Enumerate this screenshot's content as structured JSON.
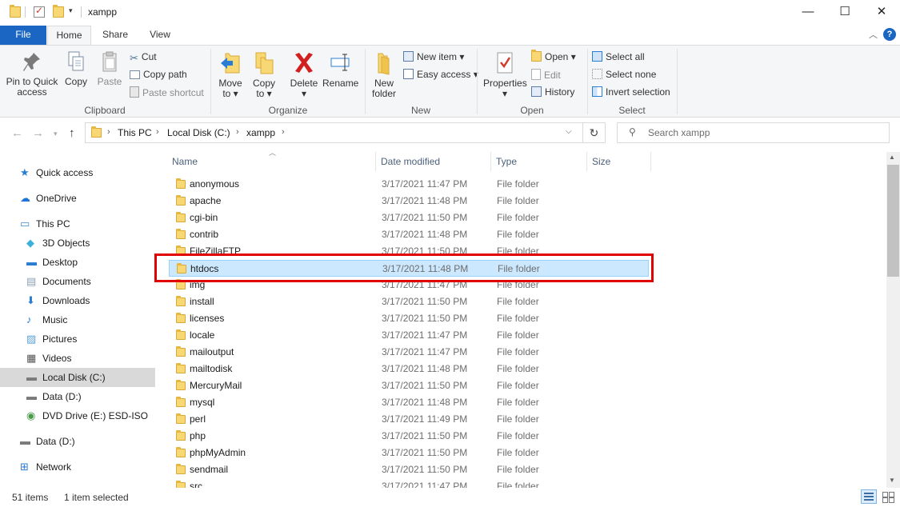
{
  "window": {
    "title": "xampp",
    "minimize": "—",
    "maximize": "☐",
    "close": "✕"
  },
  "tabs": {
    "file": "File",
    "home": "Home",
    "share": "Share",
    "view": "View"
  },
  "ribbon": {
    "clipboard": {
      "label": "Clipboard",
      "pin": "Pin to Quick access",
      "pin_l1": "Pin to Quick",
      "pin_l2": "access",
      "copy": "Copy",
      "paste": "Paste",
      "cut": "Cut",
      "copy_path": "Copy path",
      "paste_shortcut": "Paste shortcut"
    },
    "organize": {
      "label": "Organize",
      "move_to": "Move",
      "move_to2": "to",
      "copy_to": "Copy",
      "copy_to2": "to",
      "delete": "Delete",
      "rename": "Rename"
    },
    "new": {
      "label": "New",
      "new_folder_l1": "New",
      "new_folder_l2": "folder",
      "new_item": "New item",
      "easy_access": "Easy access"
    },
    "open": {
      "label": "Open",
      "properties": "Properties",
      "open": "Open",
      "edit": "Edit",
      "history": "History"
    },
    "select": {
      "label": "Select",
      "select_all": "Select all",
      "select_none": "Select none",
      "invert": "Invert selection"
    }
  },
  "address": {
    "crumbs": [
      "This PC",
      "Local Disk (C:)",
      "xampp"
    ],
    "search_placeholder": "Search xampp"
  },
  "nav": [
    {
      "label": "Quick access",
      "icon": "star-icon",
      "indent": 1
    },
    {
      "label": "OneDrive",
      "icon": "cloud-icon",
      "indent": 1
    },
    {
      "label": "This PC",
      "icon": "computer-icon",
      "indent": 1
    },
    {
      "label": "3D Objects",
      "icon": "cube-icon",
      "indent": 2
    },
    {
      "label": "Desktop",
      "icon": "desktop-icon",
      "indent": 2
    },
    {
      "label": "Documents",
      "icon": "document-icon",
      "indent": 2
    },
    {
      "label": "Downloads",
      "icon": "download-icon",
      "indent": 2
    },
    {
      "label": "Music",
      "icon": "music-icon",
      "indent": 2
    },
    {
      "label": "Pictures",
      "icon": "picture-icon",
      "indent": 2
    },
    {
      "label": "Videos",
      "icon": "video-icon",
      "indent": 2
    },
    {
      "label": "Local Disk (C:)",
      "icon": "drive-icon",
      "indent": 2
    },
    {
      "label": "Data (D:)",
      "icon": "drive-icon",
      "indent": 2
    },
    {
      "label": "DVD Drive (E:) ESD-ISO",
      "icon": "dvd-icon",
      "indent": 2
    },
    {
      "label": "Data (D:)",
      "icon": "drive-icon",
      "indent": 1
    },
    {
      "label": "Network",
      "icon": "network-icon",
      "indent": 1
    }
  ],
  "columns": {
    "name": "Name",
    "date": "Date modified",
    "type": "Type",
    "size": "Size"
  },
  "files": [
    {
      "name": "anonymous",
      "date": "3/17/2021 11:47 PM",
      "type": "File folder"
    },
    {
      "name": "apache",
      "date": "3/17/2021 11:48 PM",
      "type": "File folder"
    },
    {
      "name": "cgi-bin",
      "date": "3/17/2021 11:50 PM",
      "type": "File folder"
    },
    {
      "name": "contrib",
      "date": "3/17/2021 11:48 PM",
      "type": "File folder"
    },
    {
      "name": "FileZillaFTP",
      "date": "3/17/2021 11:50 PM",
      "type": "File folder"
    },
    {
      "name": "htdocs",
      "date": "3/17/2021 11:48 PM",
      "type": "File folder"
    },
    {
      "name": "img",
      "date": "3/17/2021 11:47 PM",
      "type": "File folder"
    },
    {
      "name": "install",
      "date": "3/17/2021 11:50 PM",
      "type": "File folder"
    },
    {
      "name": "licenses",
      "date": "3/17/2021 11:50 PM",
      "type": "File folder"
    },
    {
      "name": "locale",
      "date": "3/17/2021 11:47 PM",
      "type": "File folder"
    },
    {
      "name": "mailoutput",
      "date": "3/17/2021 11:47 PM",
      "type": "File folder"
    },
    {
      "name": "mailtodisk",
      "date": "3/17/2021 11:48 PM",
      "type": "File folder"
    },
    {
      "name": "MercuryMail",
      "date": "3/17/2021 11:50 PM",
      "type": "File folder"
    },
    {
      "name": "mysql",
      "date": "3/17/2021 11:48 PM",
      "type": "File folder"
    },
    {
      "name": "perl",
      "date": "3/17/2021 11:49 PM",
      "type": "File folder"
    },
    {
      "name": "php",
      "date": "3/17/2021 11:50 PM",
      "type": "File folder"
    },
    {
      "name": "phpMyAdmin",
      "date": "3/17/2021 11:50 PM",
      "type": "File folder"
    },
    {
      "name": "sendmail",
      "date": "3/17/2021 11:50 PM",
      "type": "File folder"
    },
    {
      "name": "src",
      "date": "3/17/2021 11:47 PM",
      "type": "File folder"
    }
  ],
  "selected_file": "htdocs",
  "status": {
    "items": "51 items",
    "selected": "1 item selected"
  }
}
